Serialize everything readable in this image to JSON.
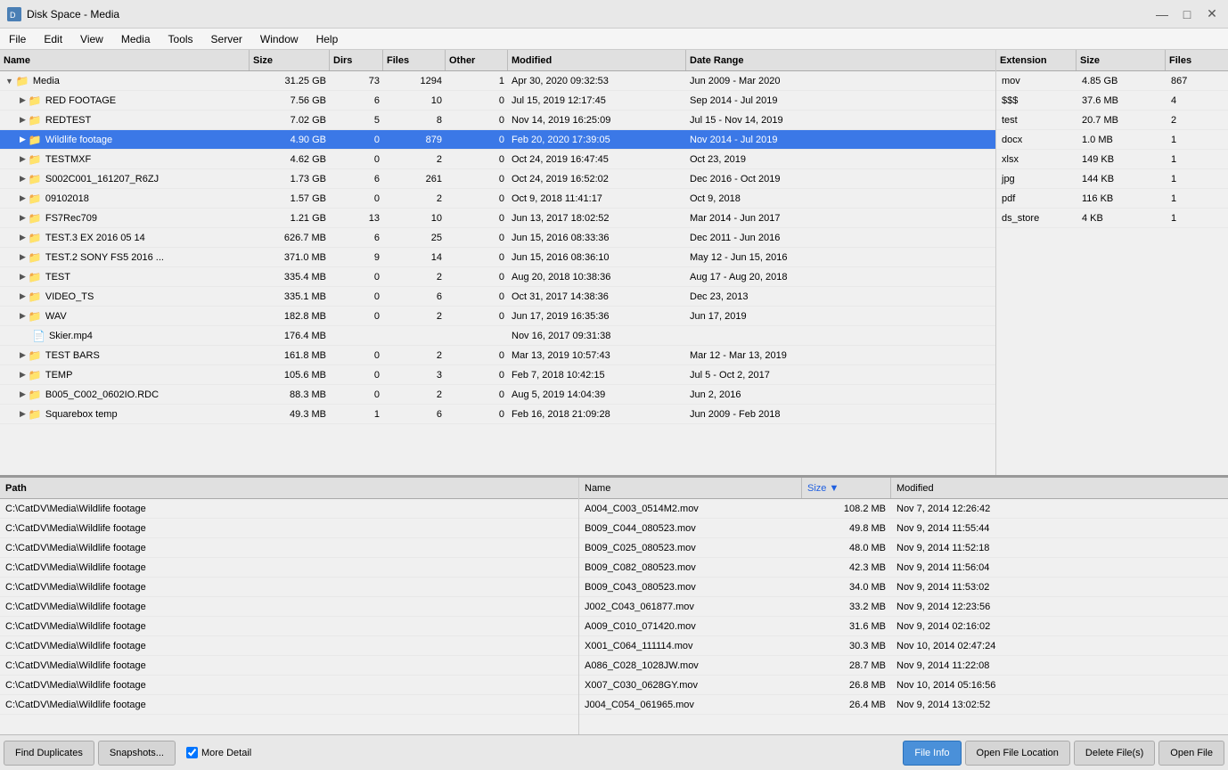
{
  "window": {
    "title": "Disk Space - Media",
    "icon": "disk-icon"
  },
  "menu": {
    "items": [
      "File",
      "Edit",
      "View",
      "Media",
      "Tools",
      "Server",
      "Window",
      "Help"
    ]
  },
  "tree": {
    "headers": [
      "Name",
      "Size",
      "Dirs",
      "Files",
      "Other",
      "Modified",
      "Date Range"
    ],
    "rows": [
      {
        "level": 0,
        "type": "folder",
        "expanded": true,
        "arrow": "▼",
        "name": "Media",
        "size": "31.25 GB",
        "dirs": "73",
        "files": "1294",
        "other": "1",
        "modified": "Apr 30, 2020 09:32:53",
        "range": "Jun 2009 - Mar 2020",
        "selected": false
      },
      {
        "level": 1,
        "type": "folder",
        "expanded": false,
        "arrow": "▶",
        "name": "RED FOOTAGE",
        "size": "7.56 GB",
        "dirs": "6",
        "files": "10",
        "other": "0",
        "modified": "Jul 15, 2019 12:17:45",
        "range": "Sep 2014 - Jul 2019",
        "selected": false
      },
      {
        "level": 1,
        "type": "folder",
        "expanded": false,
        "arrow": "▶",
        "name": "REDTEST",
        "size": "7.02 GB",
        "dirs": "5",
        "files": "8",
        "other": "0",
        "modified": "Nov 14, 2019 16:25:09",
        "range": "Jul 15 - Nov 14, 2019",
        "selected": false
      },
      {
        "level": 1,
        "type": "folder",
        "expanded": false,
        "arrow": "▶",
        "name": "Wildlife footage",
        "size": "4.90 GB",
        "dirs": "0",
        "files": "879",
        "other": "0",
        "modified": "Feb 20, 2020 17:39:05",
        "range": "Nov 2014 - Jul 2019",
        "selected": true
      },
      {
        "level": 1,
        "type": "folder",
        "expanded": false,
        "arrow": "▶",
        "name": "TESTMXF",
        "size": "4.62 GB",
        "dirs": "0",
        "files": "2",
        "other": "0",
        "modified": "Oct 24, 2019 16:47:45",
        "range": "Oct 23, 2019",
        "selected": false
      },
      {
        "level": 1,
        "type": "folder",
        "expanded": false,
        "arrow": "▶",
        "name": "S002C001_161207_R6ZJ",
        "size": "1.73 GB",
        "dirs": "6",
        "files": "261",
        "other": "0",
        "modified": "Oct 24, 2019 16:52:02",
        "range": "Dec 2016 - Oct 2019",
        "selected": false
      },
      {
        "level": 1,
        "type": "folder",
        "expanded": false,
        "arrow": "▶",
        "name": "09102018",
        "size": "1.57 GB",
        "dirs": "0",
        "files": "2",
        "other": "0",
        "modified": "Oct 9, 2018 11:41:17",
        "range": "Oct 9, 2018",
        "selected": false
      },
      {
        "level": 1,
        "type": "folder",
        "expanded": false,
        "arrow": "▶",
        "name": "FS7Rec709",
        "size": "1.21 GB",
        "dirs": "13",
        "files": "10",
        "other": "0",
        "modified": "Jun 13, 2017 18:02:52",
        "range": "Mar 2014 - Jun 2017",
        "selected": false
      },
      {
        "level": 1,
        "type": "folder",
        "expanded": false,
        "arrow": "▶",
        "name": "TEST.3 EX 2016 05 14",
        "size": "626.7 MB",
        "dirs": "6",
        "files": "25",
        "other": "0",
        "modified": "Jun 15, 2016 08:33:36",
        "range": "Dec 2011 - Jun 2016",
        "selected": false
      },
      {
        "level": 1,
        "type": "folder",
        "expanded": false,
        "arrow": "▶",
        "name": "TEST.2 SONY FS5 2016 ...",
        "size": "371.0 MB",
        "dirs": "9",
        "files": "14",
        "other": "0",
        "modified": "Jun 15, 2016 08:36:10",
        "range": "May 12 - Jun 15, 2016",
        "selected": false
      },
      {
        "level": 1,
        "type": "folder",
        "expanded": false,
        "arrow": "▶",
        "name": "TEST",
        "size": "335.4 MB",
        "dirs": "0",
        "files": "2",
        "other": "0",
        "modified": "Aug 20, 2018 10:38:36",
        "range": "Aug 17 - Aug 20, 2018",
        "selected": false
      },
      {
        "level": 1,
        "type": "folder",
        "expanded": false,
        "arrow": "▶",
        "name": "VIDEO_TS",
        "size": "335.1 MB",
        "dirs": "0",
        "files": "6",
        "other": "0",
        "modified": "Oct 31, 2017 14:38:36",
        "range": "Dec 23, 2013",
        "selected": false
      },
      {
        "level": 1,
        "type": "folder",
        "expanded": false,
        "arrow": "▶",
        "name": "WAV",
        "size": "182.8 MB",
        "dirs": "0",
        "files": "2",
        "other": "0",
        "modified": "Jun 17, 2019 16:35:36",
        "range": "Jun 17, 2019",
        "selected": false
      },
      {
        "level": 1,
        "type": "file",
        "expanded": false,
        "arrow": "",
        "name": "Skier.mp4",
        "size": "176.4 MB",
        "dirs": "",
        "files": "",
        "other": "",
        "modified": "Nov 16, 2017 09:31:38",
        "range": "",
        "selected": false
      },
      {
        "level": 1,
        "type": "folder",
        "expanded": false,
        "arrow": "▶",
        "name": "TEST BARS",
        "size": "161.8 MB",
        "dirs": "0",
        "files": "2",
        "other": "0",
        "modified": "Mar 13, 2019 10:57:43",
        "range": "Mar 12 - Mar 13, 2019",
        "selected": false
      },
      {
        "level": 1,
        "type": "folder",
        "expanded": false,
        "arrow": "▶",
        "name": "TEMP",
        "size": "105.6 MB",
        "dirs": "0",
        "files": "3",
        "other": "0",
        "modified": "Feb 7, 2018 10:42:15",
        "range": "Jul 5 - Oct 2, 2017",
        "selected": false
      },
      {
        "level": 1,
        "type": "folder",
        "expanded": false,
        "arrow": "▶",
        "name": "B005_C002_0602IO.RDC",
        "size": "88.3 MB",
        "dirs": "0",
        "files": "2",
        "other": "0",
        "modified": "Aug 5, 2019 14:04:39",
        "range": "Jun 2, 2016",
        "selected": false
      },
      {
        "level": 1,
        "type": "folder",
        "expanded": false,
        "arrow": "▶",
        "name": "Squarebox temp",
        "size": "49.3 MB",
        "dirs": "1",
        "files": "6",
        "other": "0",
        "modified": "Feb 16, 2018 21:09:28",
        "range": "Jun 2009 - Feb 2018",
        "selected": false
      }
    ]
  },
  "extensions": {
    "headers": [
      "Extension",
      "Size",
      "Files"
    ],
    "rows": [
      {
        "ext": "mov",
        "size": "4.85 GB",
        "files": "867"
      },
      {
        "ext": "$$$",
        "size": "37.6 MB",
        "files": "4"
      },
      {
        "ext": "test",
        "size": "20.7 MB",
        "files": "2"
      },
      {
        "ext": "docx",
        "size": "1.0 MB",
        "files": "1"
      },
      {
        "ext": "xlsx",
        "size": "149 KB",
        "files": "1"
      },
      {
        "ext": "jpg",
        "size": "144 KB",
        "files": "1"
      },
      {
        "ext": "pdf",
        "size": "116 KB",
        "files": "1"
      },
      {
        "ext": "ds_store",
        "size": "4 KB",
        "files": "1"
      }
    ]
  },
  "bottom": {
    "path_header": "Path",
    "file_headers": [
      "Name",
      "Size",
      "Modified"
    ],
    "paths": [
      "C:\\CatDV\\Media\\Wildlife footage",
      "C:\\CatDV\\Media\\Wildlife footage",
      "C:\\CatDV\\Media\\Wildlife footage",
      "C:\\CatDV\\Media\\Wildlife footage",
      "C:\\CatDV\\Media\\Wildlife footage",
      "C:\\CatDV\\Media\\Wildlife footage",
      "C:\\CatDV\\Media\\Wildlife footage",
      "C:\\CatDV\\Media\\Wildlife footage",
      "C:\\CatDV\\Media\\Wildlife footage",
      "C:\\CatDV\\Media\\Wildlife footage",
      "C:\\CatDV\\Media\\Wildlife footage"
    ],
    "files": [
      {
        "name": "A004_C003_0514M2.mov",
        "size": "108.2 MB",
        "modified": "Nov 7, 2014 12:26:42"
      },
      {
        "name": "B009_C044_080523.mov",
        "size": "49.8 MB",
        "modified": "Nov 9, 2014 11:55:44"
      },
      {
        "name": "B009_C025_080523.mov",
        "size": "48.0 MB",
        "modified": "Nov 9, 2014 11:52:18"
      },
      {
        "name": "B009_C082_080523.mov",
        "size": "42.3 MB",
        "modified": "Nov 9, 2014 11:56:04"
      },
      {
        "name": "B009_C043_080523.mov",
        "size": "34.0 MB",
        "modified": "Nov 9, 2014 11:53:02"
      },
      {
        "name": "J002_C043_061877.mov",
        "size": "33.2 MB",
        "modified": "Nov 9, 2014 12:23:56"
      },
      {
        "name": "A009_C010_071420.mov",
        "size": "31.6 MB",
        "modified": "Nov 9, 2014 02:16:02"
      },
      {
        "name": "X001_C064_111114.mov",
        "size": "30.3 MB",
        "modified": "Nov 10, 2014 02:47:24"
      },
      {
        "name": "A086_C028_1028JW.mov",
        "size": "28.7 MB",
        "modified": "Nov 9, 2014 11:22:08"
      },
      {
        "name": "X007_C030_0628GY.mov",
        "size": "26.8 MB",
        "modified": "Nov 10, 2014 05:16:56"
      },
      {
        "name": "J004_C054_061965.mov",
        "size": "26.4 MB",
        "modified": "Nov 9, 2014 13:02:52"
      }
    ]
  },
  "toolbar": {
    "find_duplicates": "Find Duplicates",
    "snapshots": "Snapshots...",
    "more_detail": "More Detail",
    "file_info": "File Info",
    "open_file_location": "Open File Location",
    "delete_files": "Delete File(s)",
    "open_file": "Open File"
  }
}
